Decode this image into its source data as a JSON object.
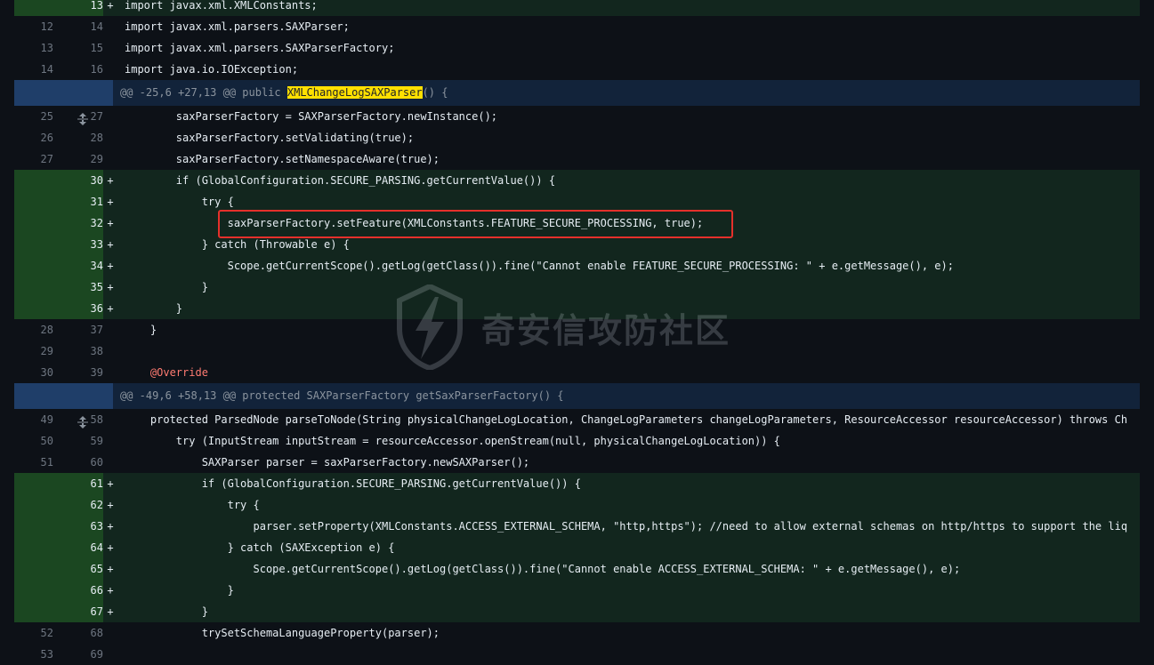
{
  "hunks": [
    {
      "header": "@@ -25,6 +27,13 @@ public ",
      "header_hl": "XMLChangeLogSAXParser",
      "header_tail": "() {"
    },
    {
      "header": "@@ -49,6 +58,13 @@ protected SAXParserFactory getSaxParserFactory() {"
    }
  ],
  "lines": [
    {
      "type": "add",
      "old": "",
      "new": "13",
      "sign": "+",
      "code": "import javax.xml.XMLConstants;"
    },
    {
      "type": "ctx",
      "old": "12",
      "new": "14",
      "sign": "",
      "code": "import javax.xml.parsers.SAXParser;"
    },
    {
      "type": "ctx",
      "old": "13",
      "new": "15",
      "sign": "",
      "code": "import javax.xml.parsers.SAXParserFactory;"
    },
    {
      "type": "ctx",
      "old": "14",
      "new": "16",
      "sign": "",
      "code": "import java.io.IOException;"
    },
    {
      "type": "ctx",
      "old": "25",
      "new": "27",
      "sign": "",
      "code": "        saxParserFactory = SAXParserFactory.newInstance();"
    },
    {
      "type": "ctx",
      "old": "26",
      "new": "28",
      "sign": "",
      "code": "        saxParserFactory.setValidating(true);"
    },
    {
      "type": "ctx",
      "old": "27",
      "new": "29",
      "sign": "",
      "code": "        saxParserFactory.setNamespaceAware(true);"
    },
    {
      "type": "add",
      "old": "",
      "new": "30",
      "sign": "+",
      "code": "        if (GlobalConfiguration.SECURE_PARSING.getCurrentValue()) {"
    },
    {
      "type": "add",
      "old": "",
      "new": "31",
      "sign": "+",
      "code": "            try {"
    },
    {
      "type": "add",
      "old": "",
      "new": "32",
      "sign": "+",
      "code": "                saxParserFactory.setFeature(XMLConstants.FEATURE_SECURE_PROCESSING, true);"
    },
    {
      "type": "add",
      "old": "",
      "new": "33",
      "sign": "+",
      "code": "            } catch (Throwable e) {"
    },
    {
      "type": "add",
      "old": "",
      "new": "34",
      "sign": "+",
      "code": "                Scope.getCurrentScope().getLog(getClass()).fine(\"Cannot enable FEATURE_SECURE_PROCESSING: \" + e.getMessage(), e);"
    },
    {
      "type": "add",
      "old": "",
      "new": "35",
      "sign": "+",
      "code": "            }"
    },
    {
      "type": "add",
      "old": "",
      "new": "36",
      "sign": "+",
      "code": "        }"
    },
    {
      "type": "ctx",
      "old": "28",
      "new": "37",
      "sign": "",
      "code": "    }"
    },
    {
      "type": "ctx",
      "old": "29",
      "new": "38",
      "sign": "",
      "code": ""
    },
    {
      "type": "ctx",
      "old": "30",
      "new": "39",
      "sign": "",
      "code": "    @Override"
    },
    {
      "type": "ctx",
      "old": "49",
      "new": "58",
      "sign": "",
      "code": "    protected ParsedNode parseToNode(String physicalChangeLogLocation, ChangeLogParameters changeLogParameters, ResourceAccessor resourceAccessor) throws Ch"
    },
    {
      "type": "ctx",
      "old": "50",
      "new": "59",
      "sign": "",
      "code": "        try (InputStream inputStream = resourceAccessor.openStream(null, physicalChangeLogLocation)) {"
    },
    {
      "type": "ctx",
      "old": "51",
      "new": "60",
      "sign": "",
      "code": "            SAXParser parser = saxParserFactory.newSAXParser();"
    },
    {
      "type": "add",
      "old": "",
      "new": "61",
      "sign": "+",
      "code": "            if (GlobalConfiguration.SECURE_PARSING.getCurrentValue()) {"
    },
    {
      "type": "add",
      "old": "",
      "new": "62",
      "sign": "+",
      "code": "                try {"
    },
    {
      "type": "add",
      "old": "",
      "new": "63",
      "sign": "+",
      "code": "                    parser.setProperty(XMLConstants.ACCESS_EXTERNAL_SCHEMA, \"http,https\"); //need to allow external schemas on http/https to support the liq"
    },
    {
      "type": "add",
      "old": "",
      "new": "64",
      "sign": "+",
      "code": "                } catch (SAXException e) {"
    },
    {
      "type": "add",
      "old": "",
      "new": "65",
      "sign": "+",
      "code": "                    Scope.getCurrentScope().getLog(getClass()).fine(\"Cannot enable ACCESS_EXTERNAL_SCHEMA: \" + e.getMessage(), e);"
    },
    {
      "type": "add",
      "old": "",
      "new": "66",
      "sign": "+",
      "code": "                }"
    },
    {
      "type": "add",
      "old": "",
      "new": "67",
      "sign": "+",
      "code": "            }"
    },
    {
      "type": "ctx",
      "old": "52",
      "new": "68",
      "sign": "",
      "code": "            trySetSchemaLanguageProperty(parser);"
    },
    {
      "type": "ctx",
      "old": "53",
      "new": "69",
      "sign": "",
      "code": ""
    }
  ],
  "watermark": "奇安信攻防社区",
  "colors": {
    "highlight_box": "#e5302b",
    "add_bg": "#12261e",
    "hunk_bg": "#12233a"
  }
}
